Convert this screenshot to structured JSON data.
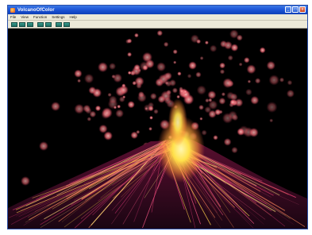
{
  "window": {
    "title": "VolcanoOfColor",
    "controls": {
      "minimize": "_",
      "maximize": "□",
      "close": "x"
    }
  },
  "menu": {
    "items": [
      {
        "label": "File"
      },
      {
        "label": "View"
      },
      {
        "label": "Function"
      },
      {
        "label": "Settings"
      },
      {
        "label": "Help"
      }
    ]
  },
  "toolbar": {
    "buttons": [
      {
        "icon": "toolbar-button-1"
      },
      {
        "icon": "toolbar-button-2"
      },
      {
        "icon": "toolbar-button-3"
      },
      {
        "icon": "toolbar-button-4"
      },
      {
        "icon": "toolbar-button-5"
      },
      {
        "icon": "toolbar-button-6"
      },
      {
        "icon": "toolbar-button-7"
      }
    ]
  },
  "scene": {
    "subject": "volcano-eruption-particles",
    "colors": {
      "lava_core": "#ffe14a",
      "ember": "#ff6a73",
      "slope": "#b0204a",
      "background": "#000000"
    }
  }
}
